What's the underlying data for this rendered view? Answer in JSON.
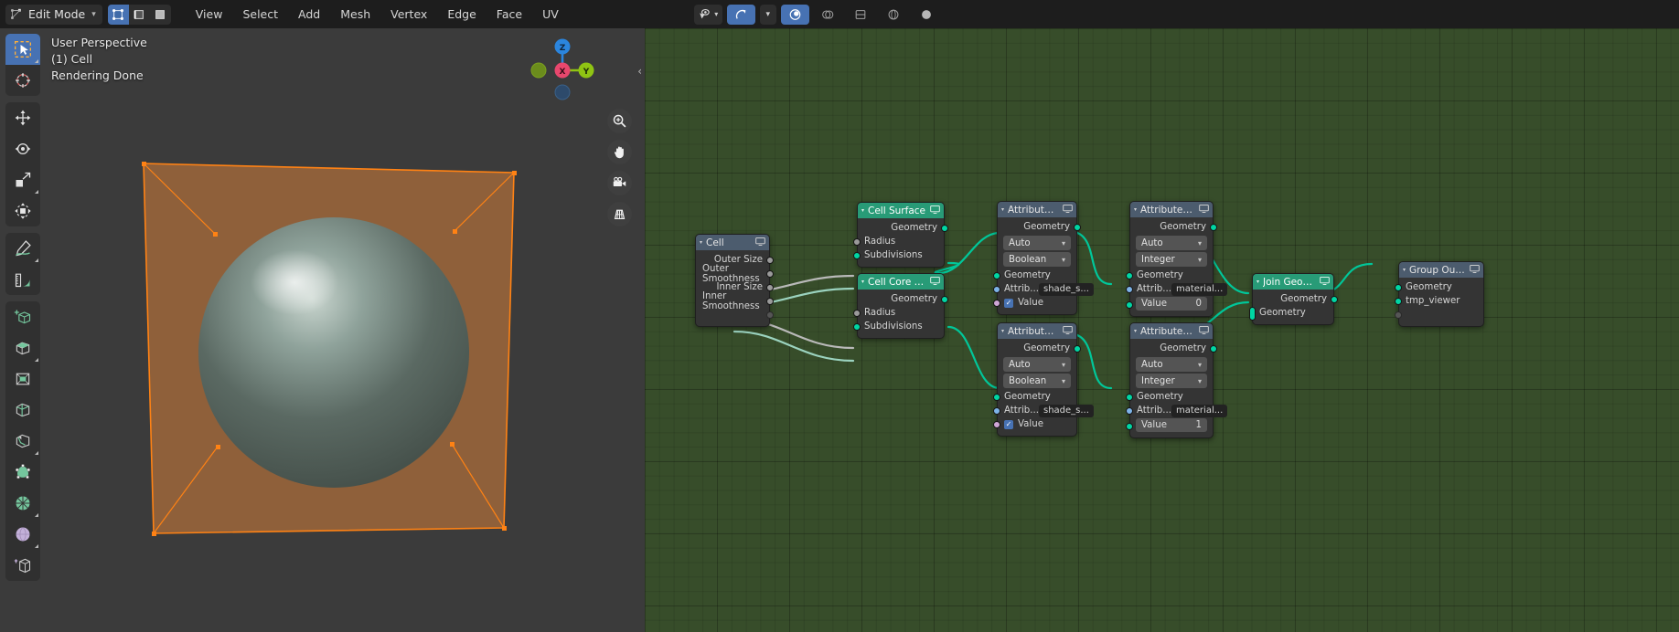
{
  "header": {
    "mode": {
      "label": "Edit Mode",
      "icon": "edit-mode-icon",
      "chevron": "▾"
    },
    "select_modes": [
      {
        "name": "vertex-select-mode",
        "active": true
      },
      {
        "name": "edge-select-mode",
        "active": false
      },
      {
        "name": "face-select-mode",
        "active": false
      }
    ],
    "menus": [
      "View",
      "Select",
      "Add",
      "Mesh",
      "Vertex",
      "Edge",
      "Face",
      "UV"
    ],
    "right_tools": [
      {
        "name": "visibility-icon",
        "label": "▾"
      },
      {
        "name": "snap-magnet-icon",
        "active": true
      },
      {
        "name": "snap-dropdown",
        "label": "▾"
      },
      {
        "name": "proportional-editing-icon",
        "active": true
      },
      {
        "name": "viewport-shading-wire",
        "active": false
      },
      {
        "name": "viewport-shading-solid",
        "active": false
      },
      {
        "name": "viewport-shading-material",
        "active": false
      },
      {
        "name": "viewport-shading-rendered",
        "active": false
      }
    ]
  },
  "viewport": {
    "overlay": {
      "perspective": "User Perspective",
      "collection": "(1) Cell",
      "status": "Rendering Done"
    },
    "gizmo": {
      "axes": [
        {
          "label": "Z",
          "color": "#2b85dd"
        },
        {
          "label": "X",
          "color": "#e8476d"
        },
        {
          "label": "Y",
          "color": "#8fc413"
        },
        {
          "label": "",
          "color": "#6b8c1c"
        },
        {
          "label": "",
          "color": "#2d4a6b"
        }
      ]
    },
    "nav_buttons": [
      {
        "name": "zoom-nav-icon"
      },
      {
        "name": "pan-hand-icon"
      },
      {
        "name": "camera-view-icon"
      },
      {
        "name": "ortho-perspective-icon"
      }
    ],
    "collapse_icon": "‹",
    "toolbar": [
      {
        "name": "tweak-select-box-tool",
        "active": true,
        "icon": "cursor-box-icon"
      },
      {
        "name": "cursor-tool",
        "active": false,
        "icon": "3d-cursor-icon"
      },
      {
        "name": "move-tool",
        "active": false,
        "icon": "move-arrows-icon"
      },
      {
        "name": "rotate-tool",
        "active": false,
        "icon": "rotate-icon"
      },
      {
        "name": "scale-tool",
        "active": false,
        "icon": "scale-icon"
      },
      {
        "name": "transform-tool",
        "active": false,
        "icon": "transform-icon"
      },
      {
        "name": "annotate-tool",
        "active": false,
        "icon": "pencil-icon"
      },
      {
        "name": "measure-tool",
        "active": false,
        "icon": "ruler-icon"
      },
      {
        "name": "add-cube-tool",
        "active": false,
        "icon": "add-cube-icon"
      },
      {
        "name": "extrude-region-tool",
        "active": false,
        "icon": "extrude-icon"
      },
      {
        "name": "inset-faces-tool",
        "active": false,
        "icon": "inset-faces-icon"
      },
      {
        "name": "bevel-tool",
        "active": false,
        "icon": "bevel-icon"
      },
      {
        "name": "loop-cut-tool",
        "active": false,
        "icon": "loop-cut-icon"
      },
      {
        "name": "knife-tool",
        "active": false,
        "icon": "knife-icon"
      },
      {
        "name": "poly-build-tool",
        "active": false,
        "icon": "poly-build-icon"
      },
      {
        "name": "spin-tool",
        "active": false,
        "icon": "spin-icon"
      },
      {
        "name": "smooth-tool",
        "active": false,
        "icon": "smooth-sphere-icon"
      },
      {
        "name": "shear-tool",
        "active": false,
        "icon": "shear-icon"
      }
    ]
  },
  "node_editor": {
    "nodes": [
      {
        "id": "cell",
        "title": "Cell",
        "header_color": "grey",
        "outputs": [
          "Outer Size",
          "Outer Smoothness",
          "Inner Size",
          "Inner Smoothness"
        ]
      },
      {
        "id": "cell-surface",
        "title": "Cell Surface",
        "header_color": "green",
        "outputs": [
          "Geometry"
        ],
        "inputs": [
          "Radius",
          "Subdivisions"
        ]
      },
      {
        "id": "cell-core-surface",
        "title": "Cell Core Surface",
        "header_color": "green",
        "outputs": [
          "Geometry"
        ],
        "inputs": [
          "Radius",
          "Subdivisions"
        ]
      },
      {
        "id": "attribute-fill-1",
        "title": "Attribute Fill",
        "header_color": "grey",
        "outputs": [
          "Geometry"
        ],
        "domain": "Auto",
        "data_type": "Boolean",
        "inputs": [
          "Geometry"
        ],
        "attribute_label": "Attrib...",
        "attribute_value": "shade_s...",
        "value_label": "Value",
        "value_checked": true
      },
      {
        "id": "attribute-fill-2",
        "title": "Attribute Fill",
        "header_color": "grey",
        "outputs": [
          "Geometry"
        ],
        "domain": "Auto",
        "data_type": "Integer",
        "inputs": [
          "Geometry"
        ],
        "attribute_label": "Attrib...",
        "attribute_value": "material...",
        "value_label": "Value",
        "value_number": "0"
      },
      {
        "id": "attribute-fill-3",
        "title": "Attribute Fill",
        "header_color": "grey",
        "outputs": [
          "Geometry"
        ],
        "domain": "Auto",
        "data_type": "Boolean",
        "inputs": [
          "Geometry"
        ],
        "attribute_label": "Attrib...",
        "attribute_value": "shade_s...",
        "value_label": "Value",
        "value_checked": true
      },
      {
        "id": "attribute-fill-4",
        "title": "Attribute Fill",
        "header_color": "grey",
        "outputs": [
          "Geometry"
        ],
        "domain": "Auto",
        "data_type": "Integer",
        "inputs": [
          "Geometry"
        ],
        "attribute_label": "Attrib...",
        "attribute_value": "material...",
        "value_label": "Value",
        "value_number": "1"
      },
      {
        "id": "join-geometry",
        "title": "Join Geometry",
        "header_color": "green",
        "outputs": [
          "Geometry"
        ],
        "inputs": [
          "Geometry"
        ]
      },
      {
        "id": "group-output",
        "title": "Group Output",
        "header_color": "grey",
        "inputs": [
          "Geometry",
          "tmp_viewer"
        ]
      }
    ]
  }
}
